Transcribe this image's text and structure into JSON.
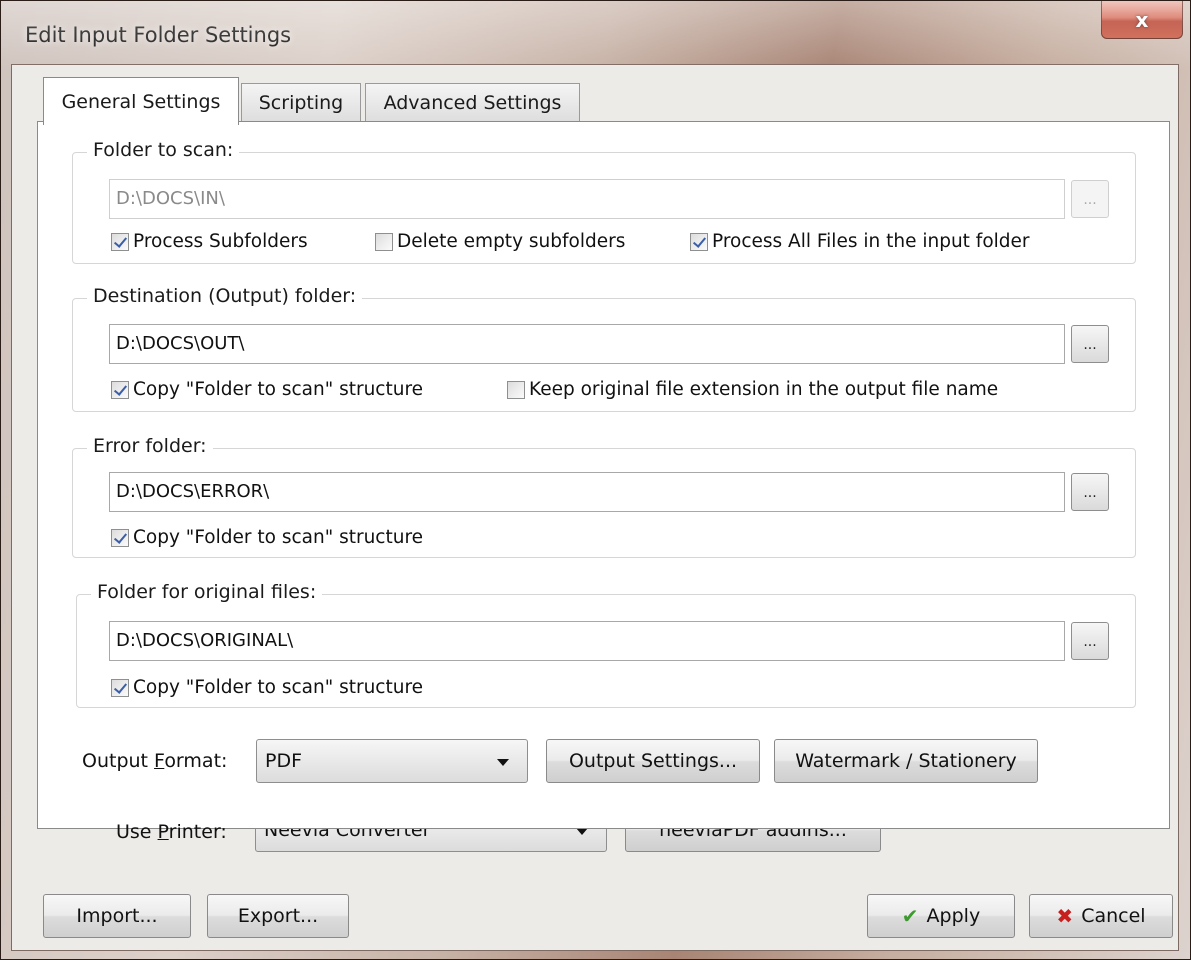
{
  "window": {
    "title": "Edit Input Folder Settings",
    "close_glyph": "x"
  },
  "tabs": [
    {
      "label": "General Settings",
      "active": true
    },
    {
      "label": "Scripting",
      "active": false
    },
    {
      "label": "Advanced Settings",
      "active": false
    }
  ],
  "scan_group": {
    "legend": "Folder to scan:",
    "path": "D:\\DOCS\\IN\\",
    "browse_label": "...",
    "checkboxes": [
      {
        "label": "Process Subfolders",
        "checked": true
      },
      {
        "label": "Delete empty subfolders",
        "checked": false
      },
      {
        "label": "Process All Files in the input folder",
        "checked": true
      }
    ]
  },
  "dest_group": {
    "legend": "Destination (Output) folder:",
    "path": "D:\\DOCS\\OUT\\",
    "browse_label": "...",
    "checkboxes": [
      {
        "label": "Copy \"Folder to scan\" structure",
        "checked": true
      },
      {
        "label": "Keep original file extension in the output file name",
        "checked": false
      }
    ]
  },
  "error_group": {
    "legend": "Error folder:",
    "path": "D:\\DOCS\\ERROR\\",
    "browse_label": "...",
    "checkboxes": [
      {
        "label": "Copy \"Folder to scan\" structure",
        "checked": true
      }
    ]
  },
  "original_group": {
    "legend": "Folder for original files:",
    "path": "D:\\DOCS\\ORIGINAL\\",
    "browse_label": "...",
    "checkboxes": [
      {
        "label": "Copy \"Folder to scan\" structure",
        "checked": true
      }
    ]
  },
  "output_format": {
    "label_pre": "Output ",
    "label_accel": "F",
    "label_post": "ormat:",
    "value": "PDF",
    "settings_button": "Output Settings...",
    "watermark_button": "Watermark / Stationery"
  },
  "printer": {
    "label_pre": "Use ",
    "label_accel": "P",
    "label_post": "rinter:",
    "value": "Neevia Converter",
    "addins_button": "neeviaPDF addins..."
  },
  "footer": {
    "import_button": "Import...",
    "export_button": "Export...",
    "apply_button": "Apply",
    "cancel_button": "Cancel",
    "apply_icon": "checkmark-icon",
    "cancel_icon": "x-icon"
  },
  "colors": {
    "apply_icon": "#3c9a2e",
    "cancel_icon": "#c81e1e",
    "checkmark": "#3a5ea8"
  }
}
